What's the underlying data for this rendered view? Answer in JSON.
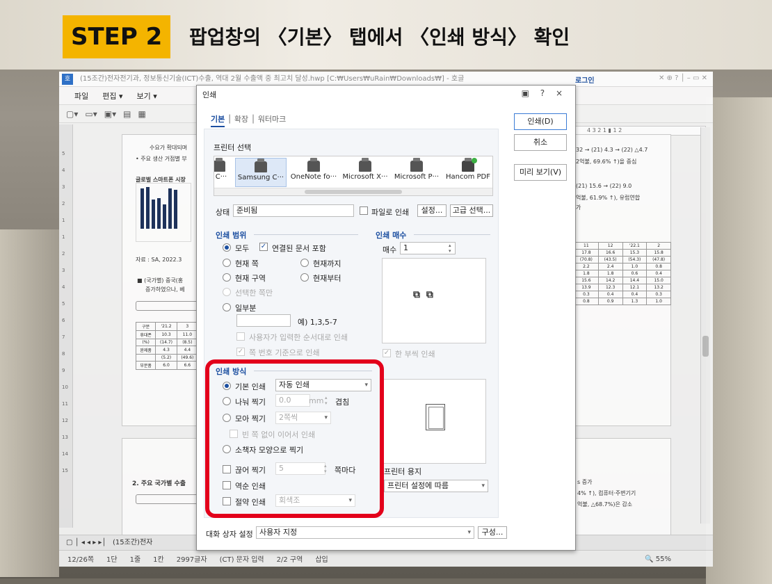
{
  "banner": {
    "step": "STEP 2",
    "title": "팝업창의 〈기본〉 탭에서 〈인쇄 방식〉 확인"
  },
  "hwp": {
    "window_title": "(15조간)전자전기과, 정보통신기술(ICT)수출, 역대 2월 수출액 중 최고치 달성.hwp [C:₩Users₩uRain₩Downloads₩] - 호글",
    "login": "로그인",
    "menu": [
      "파일",
      "편집 ▾",
      "보기 ▾"
    ],
    "doc_tab": "(15조간)전자",
    "status": {
      "page": "12/26쪽",
      "section": "1단",
      "line": "1줄",
      "col": "1칸",
      "chars": "2997글자",
      "mode": "(CT) 문자 입력",
      "area": "2/2 구역",
      "ins": "삽입"
    },
    "zoom": "55%",
    "doc_texts": [
      "수요가 확대되며",
      "• 주요 생산 거점별 부",
      "글로벌 스마트폰 시장",
      "자료 : SA, 2022.3",
      "■ (국가별) 중국(홍",
      "증가하였으나, 베",
      "2. 주요 국가별 수출",
      "32 → (21) 4.3 → (22) △4.7",
      "2억불, 69.6% ↑)을 중심",
      "(21) 15.6 → (22) 9.0",
      "억불, 61.9% ↑), 유럽연합",
      "가",
      "s 증가",
      "4% ↑), 컴퓨터·주변기기",
      "억불, △68.7%)은 감소"
    ]
  },
  "dialog": {
    "title": "인쇄",
    "controls": "▣ ? ×",
    "tabs": [
      "기본",
      "확장",
      "워터마크"
    ],
    "buttons": {
      "print": "인쇄(D)",
      "cancel": "취소",
      "preview": "미리 보기(V)"
    },
    "printer_section": "프린터 선택",
    "printers": [
      "j C···",
      "Samsung C···",
      "OneNote fo···",
      "Microsoft X···",
      "Microsoft P···",
      "Hancom PDF"
    ],
    "state_label": "상태",
    "state_value": "준비됨",
    "to_file": "파일로 인쇄",
    "settings_btn": "설정...",
    "advanced_btn": "고급 선택...",
    "range_section": "인쇄 범위",
    "range": {
      "all": "모두",
      "linked": "연결된 문서 포함",
      "current_page": "현재 쪽",
      "to_current": "현재까지",
      "current_area": "현재 구역",
      "from_current": "현재부터",
      "selection": "선택한 쪽만",
      "partial": "일부분",
      "example": "예) 1,3,5-7",
      "user_order": "사용자가 입력한 순서대로 인쇄",
      "page_num_base": "쪽 번호 기준으로 인쇄"
    },
    "copies_section": "인쇄 매수",
    "copies_label": "매수",
    "copies_value": "1",
    "collate": "한 부씩 인쇄",
    "method_section": "인쇄 방식",
    "method": {
      "basic": "기본 인쇄",
      "basic_value": "자동 인쇄",
      "split": "나눠 찍기",
      "split_value": "0.0",
      "split_unit": "mm",
      "overlap": "겹침",
      "gather": "모아 찍기",
      "gather_value": "2쪽씩",
      "no_blank": "빈 쪽 없이 이어서 인쇄",
      "booklet": "소책자 모양으로 찍기",
      "cut": "끊어 찍기",
      "cut_value": "5",
      "cut_unit": "쪽마다",
      "reverse": "역순 인쇄",
      "saving": "절약 인쇄",
      "saving_value": "회색조"
    },
    "paper_section": "프린터 용지",
    "paper_value": "프린터 설정에 따름",
    "dialog_setting_label": "대화 상자 설정",
    "dialog_setting_value": "사용자 지정",
    "configure_btn": "구성..."
  }
}
